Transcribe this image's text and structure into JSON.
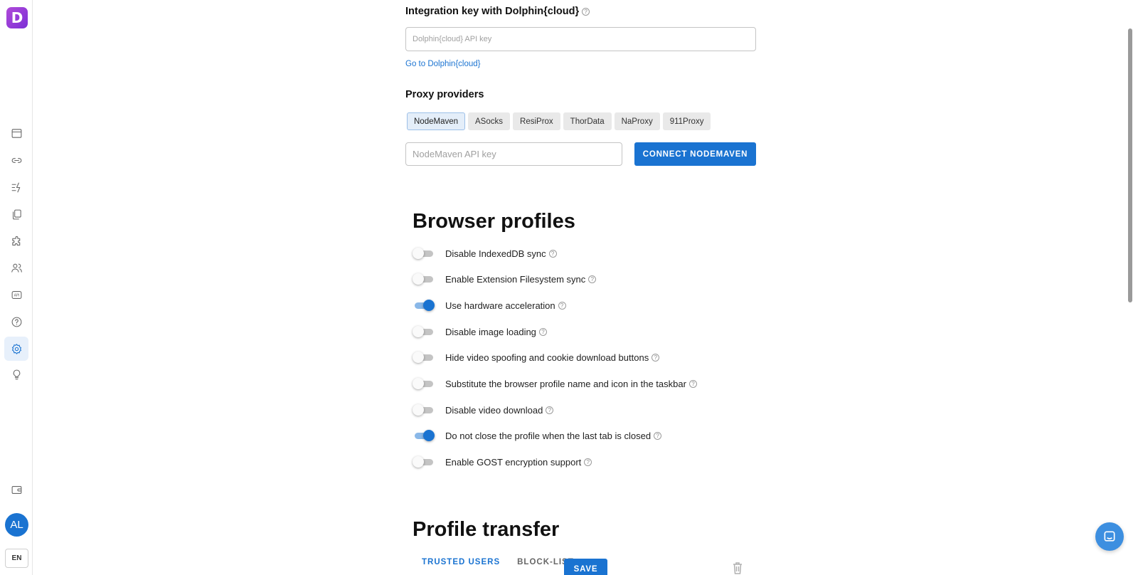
{
  "sidebar": {
    "logo_letter": "D",
    "nav_icons": [
      "browser-window-icon",
      "link-icon",
      "automation-icon",
      "copy-icon",
      "puzzle-icon",
      "users-icon",
      "api-icon",
      "help-icon",
      "settings-icon",
      "bulb-icon",
      "wallet-icon"
    ],
    "active": "settings-icon",
    "avatar_initials": "AL",
    "language": "EN"
  },
  "integration": {
    "title": "Integration key with Dolphin{cloud}",
    "api_key_placeholder": "Dolphin{cloud} API key",
    "link": "Go to Dolphin{cloud}"
  },
  "proxy": {
    "title": "Proxy providers",
    "tabs": [
      "NodeMaven",
      "ASocks",
      "ResiProx",
      "ThorData",
      "NaProxy",
      "911Proxy"
    ],
    "active_tab": "NodeMaven",
    "api_key_placeholder": "NodeMaven API key",
    "connect_button": "CONNECT NODEMAVEN"
  },
  "browser_profiles": {
    "title": "Browser profiles",
    "settings": [
      {
        "label": "Disable IndexedDB sync",
        "on": false
      },
      {
        "label": "Enable Extension Filesystem sync",
        "on": false
      },
      {
        "label": "Use hardware acceleration",
        "on": true
      },
      {
        "label": "Disable image loading",
        "on": false
      },
      {
        "label": "Hide video spoofing and cookie download buttons",
        "on": false
      },
      {
        "label": "Substitute the browser profile name and icon in the taskbar",
        "on": false
      },
      {
        "label": "Disable video download",
        "on": false
      },
      {
        "label": "Do not close the profile when the last tab is closed",
        "on": true
      },
      {
        "label": "Enable GOST encryption support",
        "on": false
      }
    ]
  },
  "profile_transfer": {
    "title": "Profile transfer",
    "tabs": [
      "TRUSTED USERS",
      "BLOCK-LIST"
    ],
    "active_tab": "TRUSTED USERS",
    "save_button": "SAVE"
  },
  "colors": {
    "accent": "#1a73d1",
    "logo_gradient_start": "#b04ad9",
    "logo_gradient_end": "#7b2fd6"
  }
}
